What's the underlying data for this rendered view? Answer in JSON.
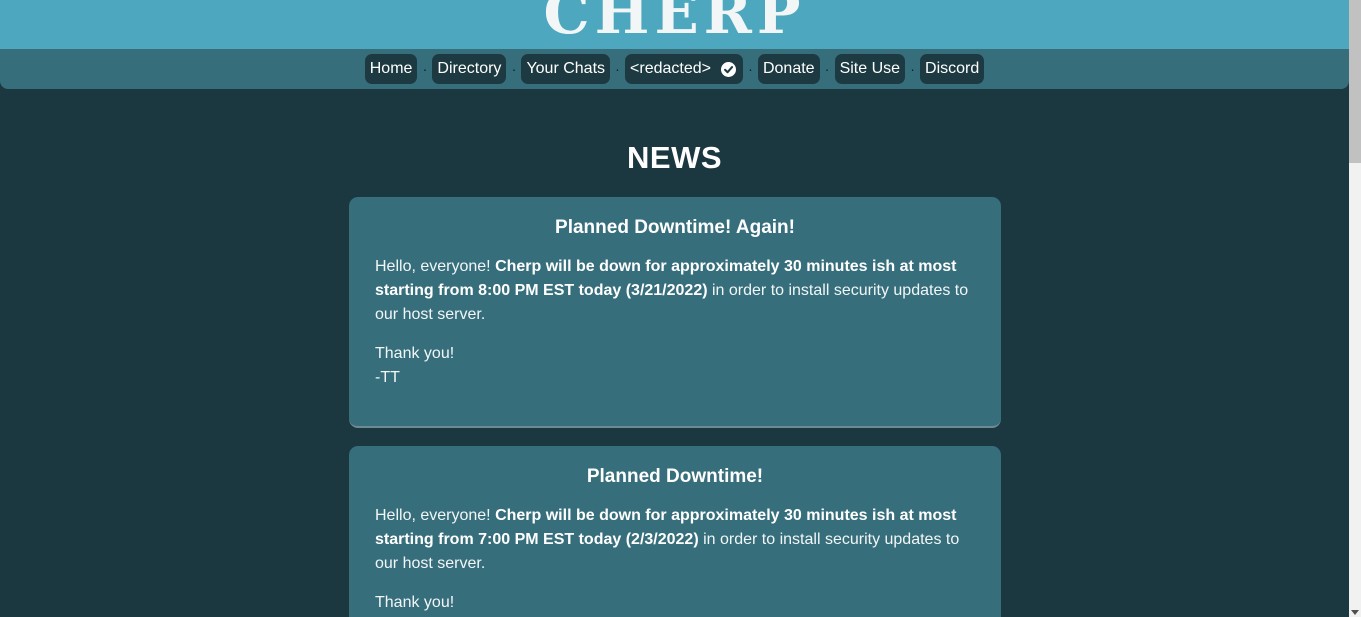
{
  "site": {
    "logo_text": "CHERP"
  },
  "nav": {
    "items": [
      {
        "label": "Home"
      },
      {
        "label": "Directory"
      },
      {
        "label": "Your Chats"
      },
      {
        "label": "<redacted>",
        "icon": "check-circle-icon"
      },
      {
        "label": "Donate"
      },
      {
        "label": "Site Use"
      },
      {
        "label": "Discord"
      }
    ],
    "separator": "·"
  },
  "news": {
    "heading": "NEWS",
    "posts": [
      {
        "title": "Planned Downtime! Again!",
        "intro": "Hello, everyone! ",
        "bold": "Cherp will be down for approximately 30 minutes ish at most starting from 8:00 PM EST today (3/21/2022)",
        "rest": " in order to install security updates to our host server.",
        "thanks": "Thank you!",
        "signature": "-TT"
      },
      {
        "title": "Planned Downtime!",
        "intro": "Hello, everyone! ",
        "bold": "Cherp will be down for approximately 30 minutes ish at most starting from 7:00 PM EST today (2/3/2022)",
        "rest": " in order to install security updates to our host server.",
        "thanks": "Thank you!",
        "signature": ""
      }
    ]
  },
  "colors": {
    "page_bg": "#1b3740",
    "header_bg": "#4da7bf",
    "nav_bg": "#366e7c",
    "nav_item_bg": "#1d3a42",
    "card_bg": "#366e7c"
  }
}
